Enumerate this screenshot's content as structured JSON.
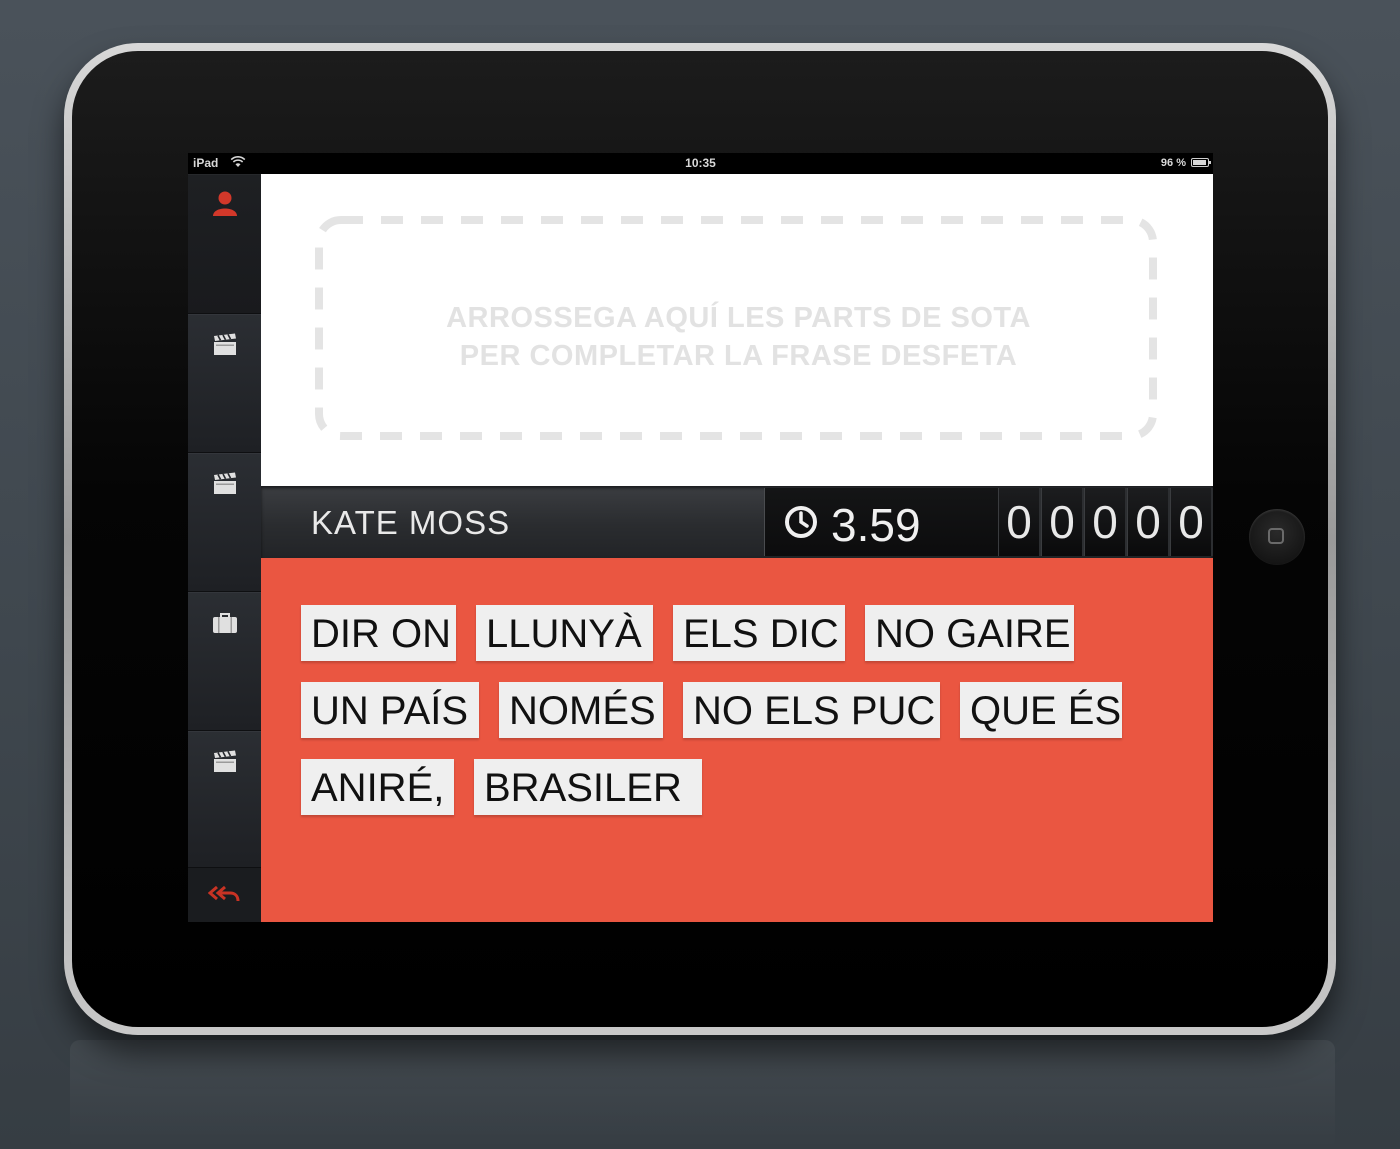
{
  "statusbar": {
    "device": "iPad",
    "time": "10:35",
    "battery_text": "96 %",
    "battery_level": 0.96
  },
  "sidebar": {
    "items": [
      {
        "icon": "user-icon",
        "active": true,
        "color": "#d2382a"
      },
      {
        "icon": "clapperboard-icon"
      },
      {
        "icon": "clapperboard-icon"
      },
      {
        "icon": "briefcase-icon"
      },
      {
        "icon": "clapperboard-icon"
      }
    ],
    "back_icon": "back-arrows-icon",
    "back_color": "#c93324"
  },
  "drop_zone": {
    "hint_line1": "ARROSSEGA AQUÍ LES PARTS DE SOTA",
    "hint_line2": "PER COMPLETAR LA FRASE DESFETA"
  },
  "info_bar": {
    "name": "KATE MOSS",
    "timer_icon": "clock-icon",
    "timer": "3.59",
    "score_digits": [
      "0",
      "0",
      "0",
      "0",
      "0"
    ]
  },
  "words": [
    [
      "DIR ON",
      "LLUNYÀ",
      "ELS DIC",
      "NO GAIRE"
    ],
    [
      "UN PAÍS",
      "NOMÉS",
      "NO ELS PUC",
      "QUE ÉS"
    ],
    [
      "ANIRÉ,",
      "BRASILER"
    ]
  ],
  "colors": {
    "accent_red": "#ea5641",
    "chip_bg": "#efefef",
    "icon_red": "#d2382a"
  }
}
